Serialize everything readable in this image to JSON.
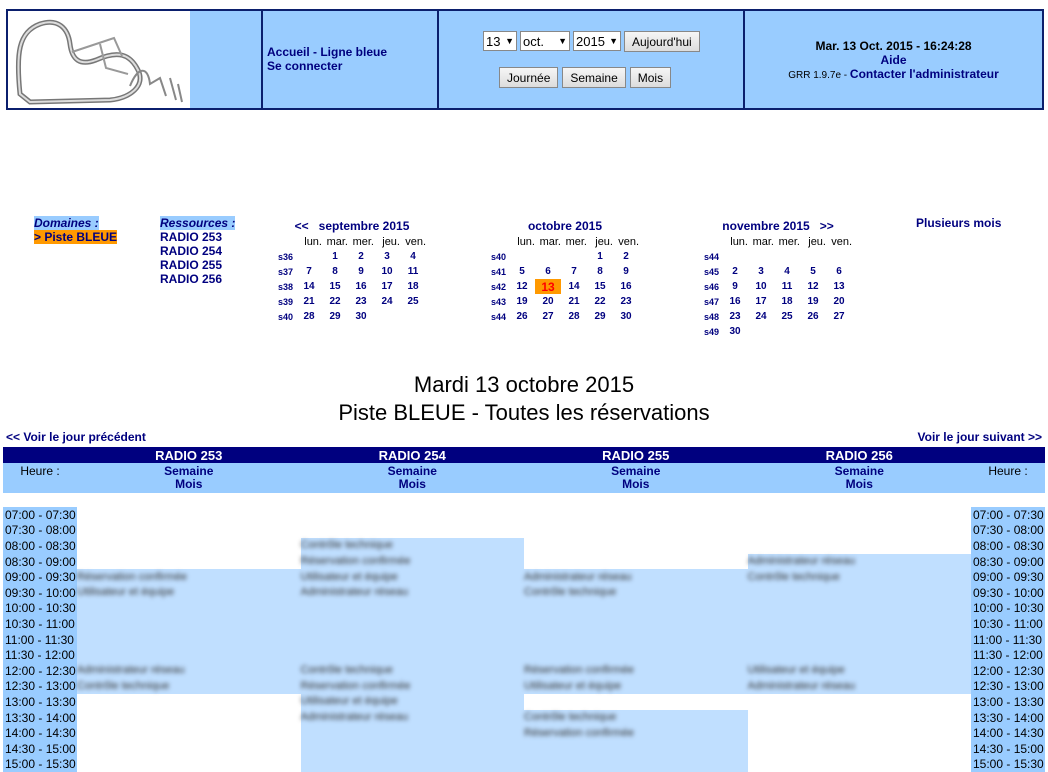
{
  "header": {
    "nav": {
      "home": "Accueil - Ligne bleue",
      "login": "Se connecter"
    },
    "date_select": {
      "day": "13",
      "month": "oct.",
      "year": "2015"
    },
    "today_button": "Aujourd'hui",
    "views": [
      "Journée",
      "Semaine",
      "Mois"
    ],
    "datetime": "Mar. 13 Oct. 2015 - 16:24:28",
    "help": "Aide",
    "version": "GRR 1.9.7e",
    "contact_sep": " - ",
    "contact": "Contacter l'administrateur"
  },
  "domains": {
    "title": "Domaines :",
    "current": "> Piste BLEUE"
  },
  "resources": {
    "title": "Ressources :",
    "items": [
      "RADIO 253",
      "RADIO 254",
      "RADIO 255",
      "RADIO 256"
    ]
  },
  "calendars": [
    {
      "title": "septembre 2015",
      "prev": "<<",
      "next": "",
      "weekdays": [
        "lun.",
        "mar.",
        "mer.",
        "jeu.",
        "ven."
      ],
      "weeks": [
        {
          "w": "s36",
          "d": [
            "",
            "1",
            "2",
            "3",
            "4"
          ]
        },
        {
          "w": "s37",
          "d": [
            "7",
            "8",
            "9",
            "10",
            "11"
          ]
        },
        {
          "w": "s38",
          "d": [
            "14",
            "15",
            "16",
            "17",
            "18"
          ]
        },
        {
          "w": "s39",
          "d": [
            "21",
            "22",
            "23",
            "24",
            "25"
          ]
        },
        {
          "w": "s40",
          "d": [
            "28",
            "29",
            "30",
            "",
            ""
          ]
        }
      ]
    },
    {
      "title": "octobre 2015",
      "prev": "",
      "next": "",
      "weekdays": [
        "lun.",
        "mar.",
        "mer.",
        "jeu.",
        "ven."
      ],
      "weeks": [
        {
          "w": "s40",
          "d": [
            "",
            "",
            "",
            "1",
            "2"
          ]
        },
        {
          "w": "s41",
          "d": [
            "5",
            "6",
            "7",
            "8",
            "9"
          ]
        },
        {
          "w": "s42",
          "d": [
            "12",
            "13",
            "14",
            "15",
            "16"
          ]
        },
        {
          "w": "s43",
          "d": [
            "19",
            "20",
            "21",
            "22",
            "23"
          ]
        },
        {
          "w": "s44",
          "d": [
            "26",
            "27",
            "28",
            "29",
            "30"
          ]
        }
      ]
    },
    {
      "title": "novembre 2015",
      "prev": "",
      "next": ">>",
      "weekdays": [
        "lun.",
        "mar.",
        "mer.",
        "jeu.",
        "ven."
      ],
      "weeks": [
        {
          "w": "s44",
          "d": [
            "",
            "",
            "",
            "",
            ""
          ]
        },
        {
          "w": "s45",
          "d": [
            "2",
            "3",
            "4",
            "5",
            "6"
          ]
        },
        {
          "w": "s46",
          "d": [
            "9",
            "10",
            "11",
            "12",
            "13"
          ]
        },
        {
          "w": "s47",
          "d": [
            "16",
            "17",
            "18",
            "19",
            "20"
          ]
        },
        {
          "w": "s48",
          "d": [
            "23",
            "24",
            "25",
            "26",
            "27"
          ]
        },
        {
          "w": "s49",
          "d": [
            "30",
            "",
            "",
            "",
            ""
          ]
        }
      ]
    }
  ],
  "today": "13",
  "multi_month": "Plusieurs mois",
  "page_title": "Mardi 13 octobre 2015",
  "page_subtitle": "Piste BLEUE - Toutes les réservations",
  "prev_day": "<< Voir le jour précédent",
  "next_day": "Voir le jour suivant >>",
  "grid": {
    "hour_label": "Heure :",
    "week_link": "Semaine",
    "month_link": "Mois",
    "resources": [
      "RADIO 253",
      "RADIO 254",
      "RADIO 255",
      "RADIO 256"
    ],
    "slots": [
      "07:00 - 07:30",
      "07:30 - 08:00",
      "08:00 - 08:30",
      "08:30 - 09:00",
      "09:00 - 09:30",
      "09:30 - 10:00",
      "10:00 - 10:30",
      "10:30 - 11:00",
      "11:00 - 11:30",
      "11:30 - 12:00",
      "12:00 - 12:30",
      "12:30 - 13:00",
      "13:00 - 13:30",
      "13:30 - 14:00",
      "14:00 - 14:30",
      "14:30 - 15:00",
      "15:00 - 15:30"
    ],
    "bookings": [
      {
        "col": 0,
        "start": 4,
        "end": 9
      },
      {
        "col": 0,
        "start": 10,
        "end": 11
      },
      {
        "col": 1,
        "start": 2,
        "end": 3
      },
      {
        "col": 1,
        "start": 4,
        "end": 9
      },
      {
        "col": 1,
        "start": 10,
        "end": 11
      },
      {
        "col": 1,
        "start": 12,
        "end": 16
      },
      {
        "col": 2,
        "start": 4,
        "end": 9
      },
      {
        "col": 2,
        "start": 10,
        "end": 11
      },
      {
        "col": 2,
        "start": 13,
        "end": 16
      },
      {
        "col": 3,
        "start": 3,
        "end": 9
      },
      {
        "col": 3,
        "start": 10,
        "end": 11
      }
    ]
  },
  "colors": {
    "header_bg": "#99ccff",
    "border": "#0b1f6d",
    "link": "#00007f",
    "highlight": "#ff9900",
    "booking": "#c0dfff"
  }
}
